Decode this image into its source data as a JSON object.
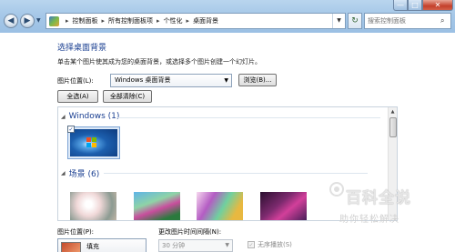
{
  "window": {
    "min_glyph": "—",
    "max_glyph": "□",
    "close_glyph": "✕"
  },
  "nav": {
    "back_glyph": "◀",
    "forward_glyph": "▶",
    "dropdown_glyph": "▼"
  },
  "breadcrumb": {
    "items": [
      "控制面板",
      "所有控制面板项",
      "个性化",
      "桌面背景"
    ],
    "separator": "▸",
    "end_glyph": "▼"
  },
  "refresh_glyph": "↻",
  "search": {
    "placeholder": "搜索控制面板",
    "icon_glyph": "⌕"
  },
  "page": {
    "title": "选择桌面背景",
    "description": "单击某个图片使其成为您的桌面背景，或选择多个图片创建一个幻灯片。",
    "location_label": "图片位置(L):",
    "location_value": "Windows 桌面背景",
    "location_arrow": "▼",
    "browse_label": "浏览(B)...",
    "select_all_label": "全选(A)",
    "clear_all_label": "全部清除(C)"
  },
  "picture_list": {
    "groups": [
      {
        "label": "Windows (1)",
        "glyph": "◢"
      },
      {
        "label": "场景 (6)",
        "glyph": "◢"
      }
    ],
    "check_glyph": "✓",
    "scroll_up_glyph": "▲"
  },
  "bottom": {
    "position_label": "图片位置(P):",
    "position_value": "填充",
    "interval_label": "更改图片时间间隔(N):",
    "interval_value": "30 分钟",
    "interval_arrow": "▼",
    "shuffle_label": "无序播放(S)",
    "shuffle_check": "✓"
  },
  "watermark": {
    "title": "百科全说",
    "subtitle": "助你轻松解决"
  },
  "colors": {
    "heading": "#1a3f91",
    "titlebar": "#a6c8e8",
    "close": "#c4402b"
  }
}
